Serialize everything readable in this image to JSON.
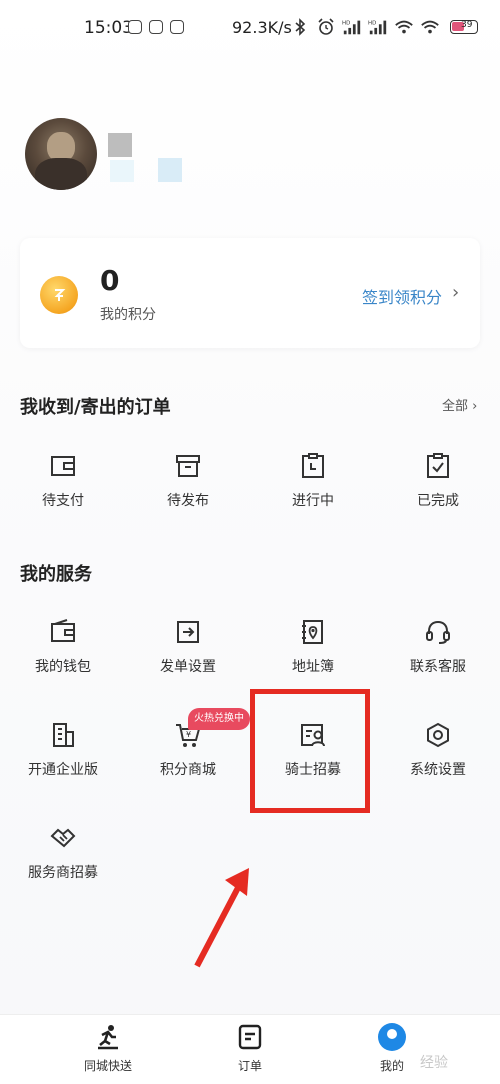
{
  "status_bar": {
    "time": "15:03",
    "net_speed": "92.3K/s",
    "battery": "39",
    "icons": [
      "shield-icon",
      "photo-icon",
      "badge-icon",
      "bluetooth-icon",
      "alarm-icon",
      "signal-hd-icon",
      "signal-hd-icon",
      "wifi-icon",
      "wifi-icon",
      "battery-icon"
    ]
  },
  "points_card": {
    "value": "0",
    "label": "我的积分",
    "signin_link": "签到领积分",
    "icon": "coin-icon"
  },
  "orders": {
    "title": "我收到/寄出的订单",
    "see_all": "全部",
    "items": [
      {
        "label": "待支付",
        "icon": "wallet-icon"
      },
      {
        "label": "待发布",
        "icon": "archive-icon"
      },
      {
        "label": "进行中",
        "icon": "clipboard-clock-icon"
      },
      {
        "label": "已完成",
        "icon": "clipboard-check-icon"
      }
    ]
  },
  "services": {
    "title": "我的服务",
    "items": [
      {
        "label": "我的钱包",
        "icon": "wallet-icon"
      },
      {
        "label": "发单设置",
        "icon": "send-settings-icon"
      },
      {
        "label": "地址簿",
        "icon": "address-book-icon"
      },
      {
        "label": "联系客服",
        "icon": "headset-icon"
      },
      {
        "label": "开通企业版",
        "icon": "building-icon"
      },
      {
        "label": "积分商城",
        "icon": "cart-icon"
      },
      {
        "label": "骑士招募",
        "icon": "rider-recruit-icon"
      },
      {
        "label": "系统设置",
        "icon": "gear-hex-icon"
      },
      {
        "label": "服务商招募",
        "icon": "handshake-icon"
      }
    ],
    "hot_badge": "火热兑换中"
  },
  "bottom_nav": {
    "items": [
      {
        "label": "同城快送",
        "icon": "runner-icon"
      },
      {
        "label": "订单",
        "icon": "order-list-icon"
      },
      {
        "label": "我的",
        "icon": "profile-icon",
        "active": true
      }
    ]
  },
  "watermark": "经验",
  "colors": {
    "accent": "#3a86c8",
    "highlight": "#e52b22",
    "badge": "#e84a5f",
    "active_nav": "#1e88e5",
    "coin": "#f5a623"
  }
}
